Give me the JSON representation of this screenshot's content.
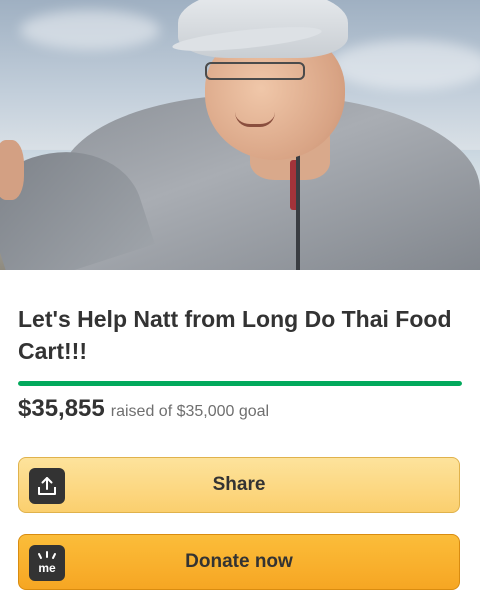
{
  "campaign": {
    "title": "Let's Help Natt from Long Do Thai Food Cart!!!",
    "amount_raised": "$35,855",
    "raised_text": "raised of $35,000 goal",
    "progress_fraction": 1.0
  },
  "buttons": {
    "share_label": "Share",
    "donate_label": "Donate now",
    "donate_icon_text": "me"
  },
  "colors": {
    "progress": "#02a95c",
    "share_bg": "#fbd57f",
    "donate_bg": "#f8b12c"
  },
  "icons": {
    "share": "share-upload-icon",
    "donate": "gofundme-me-icon"
  }
}
